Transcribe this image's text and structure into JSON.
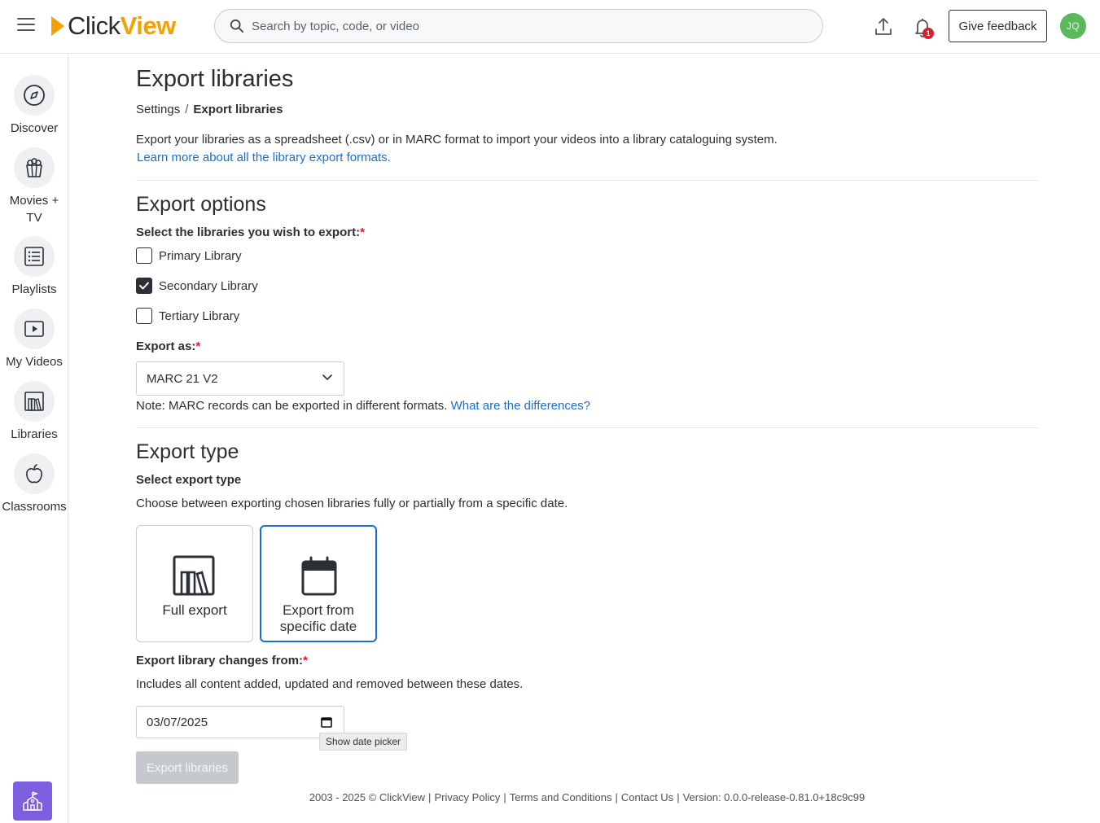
{
  "header": {
    "logo_click": "Click",
    "logo_view": "View",
    "search_placeholder": "Search by topic, code, or video",
    "notification_count": "1",
    "feedback_label": "Give feedback",
    "avatar_initials": "JQ"
  },
  "sidebar": {
    "items": [
      {
        "label": "Discover",
        "icon": "compass-icon"
      },
      {
        "label": "Movies + TV",
        "icon": "popcorn-icon"
      },
      {
        "label": "Playlists",
        "icon": "list-icon"
      },
      {
        "label": "My Videos",
        "icon": "play-icon"
      },
      {
        "label": "Libraries",
        "icon": "library-icon"
      },
      {
        "label": "Classrooms",
        "icon": "apple-icon"
      }
    ]
  },
  "page": {
    "title": "Export libraries",
    "breadcrumb": {
      "parent": "Settings",
      "separator": "/",
      "current": "Export libraries"
    },
    "intro": "Export your libraries as a spreadsheet (.csv) or in MARC format to import your videos into a library cataloguing system.",
    "intro_link": "Learn more about all the library export formats."
  },
  "export_options": {
    "heading": "Export options",
    "libraries_label": "Select the libraries you wish to export:",
    "required_mark": "*",
    "libraries": [
      {
        "label": "Primary Library",
        "checked": false
      },
      {
        "label": "Secondary Library",
        "checked": true
      },
      {
        "label": "Tertiary Library",
        "checked": false
      }
    ],
    "export_as_label": "Export as:",
    "export_as_value": "MARC 21 V2",
    "note_text": "Note: MARC records can be exported in different formats.",
    "note_link": "What are the differences?"
  },
  "export_type": {
    "heading": "Export type",
    "select_label": "Select export type",
    "description": "Choose between exporting chosen libraries fully or partially from a specific date.",
    "options": [
      {
        "label": "Full export",
        "selected": false
      },
      {
        "label_line1": "Export from",
        "label_line2": "specific date",
        "selected": true
      }
    ],
    "changes_label": "Export library changes from:",
    "changes_description": "Includes all content added, updated and removed between these dates.",
    "date_value": "03/07/2025",
    "tooltip": "Show date picker",
    "submit_label": "Export libraries"
  },
  "footer": {
    "copyright": "2003 - 2025 © ClickView",
    "privacy": "Privacy Policy",
    "terms": "Terms and Conditions",
    "contact": "Contact Us",
    "version": "Version: 0.0.0-release-0.81.0+18c9c99"
  },
  "colors": {
    "brand": "#f5a000",
    "link": "#1a6fd1",
    "required": "#d6212b",
    "avatar": "#5cb85c",
    "school_button": "#7b5fe0"
  }
}
